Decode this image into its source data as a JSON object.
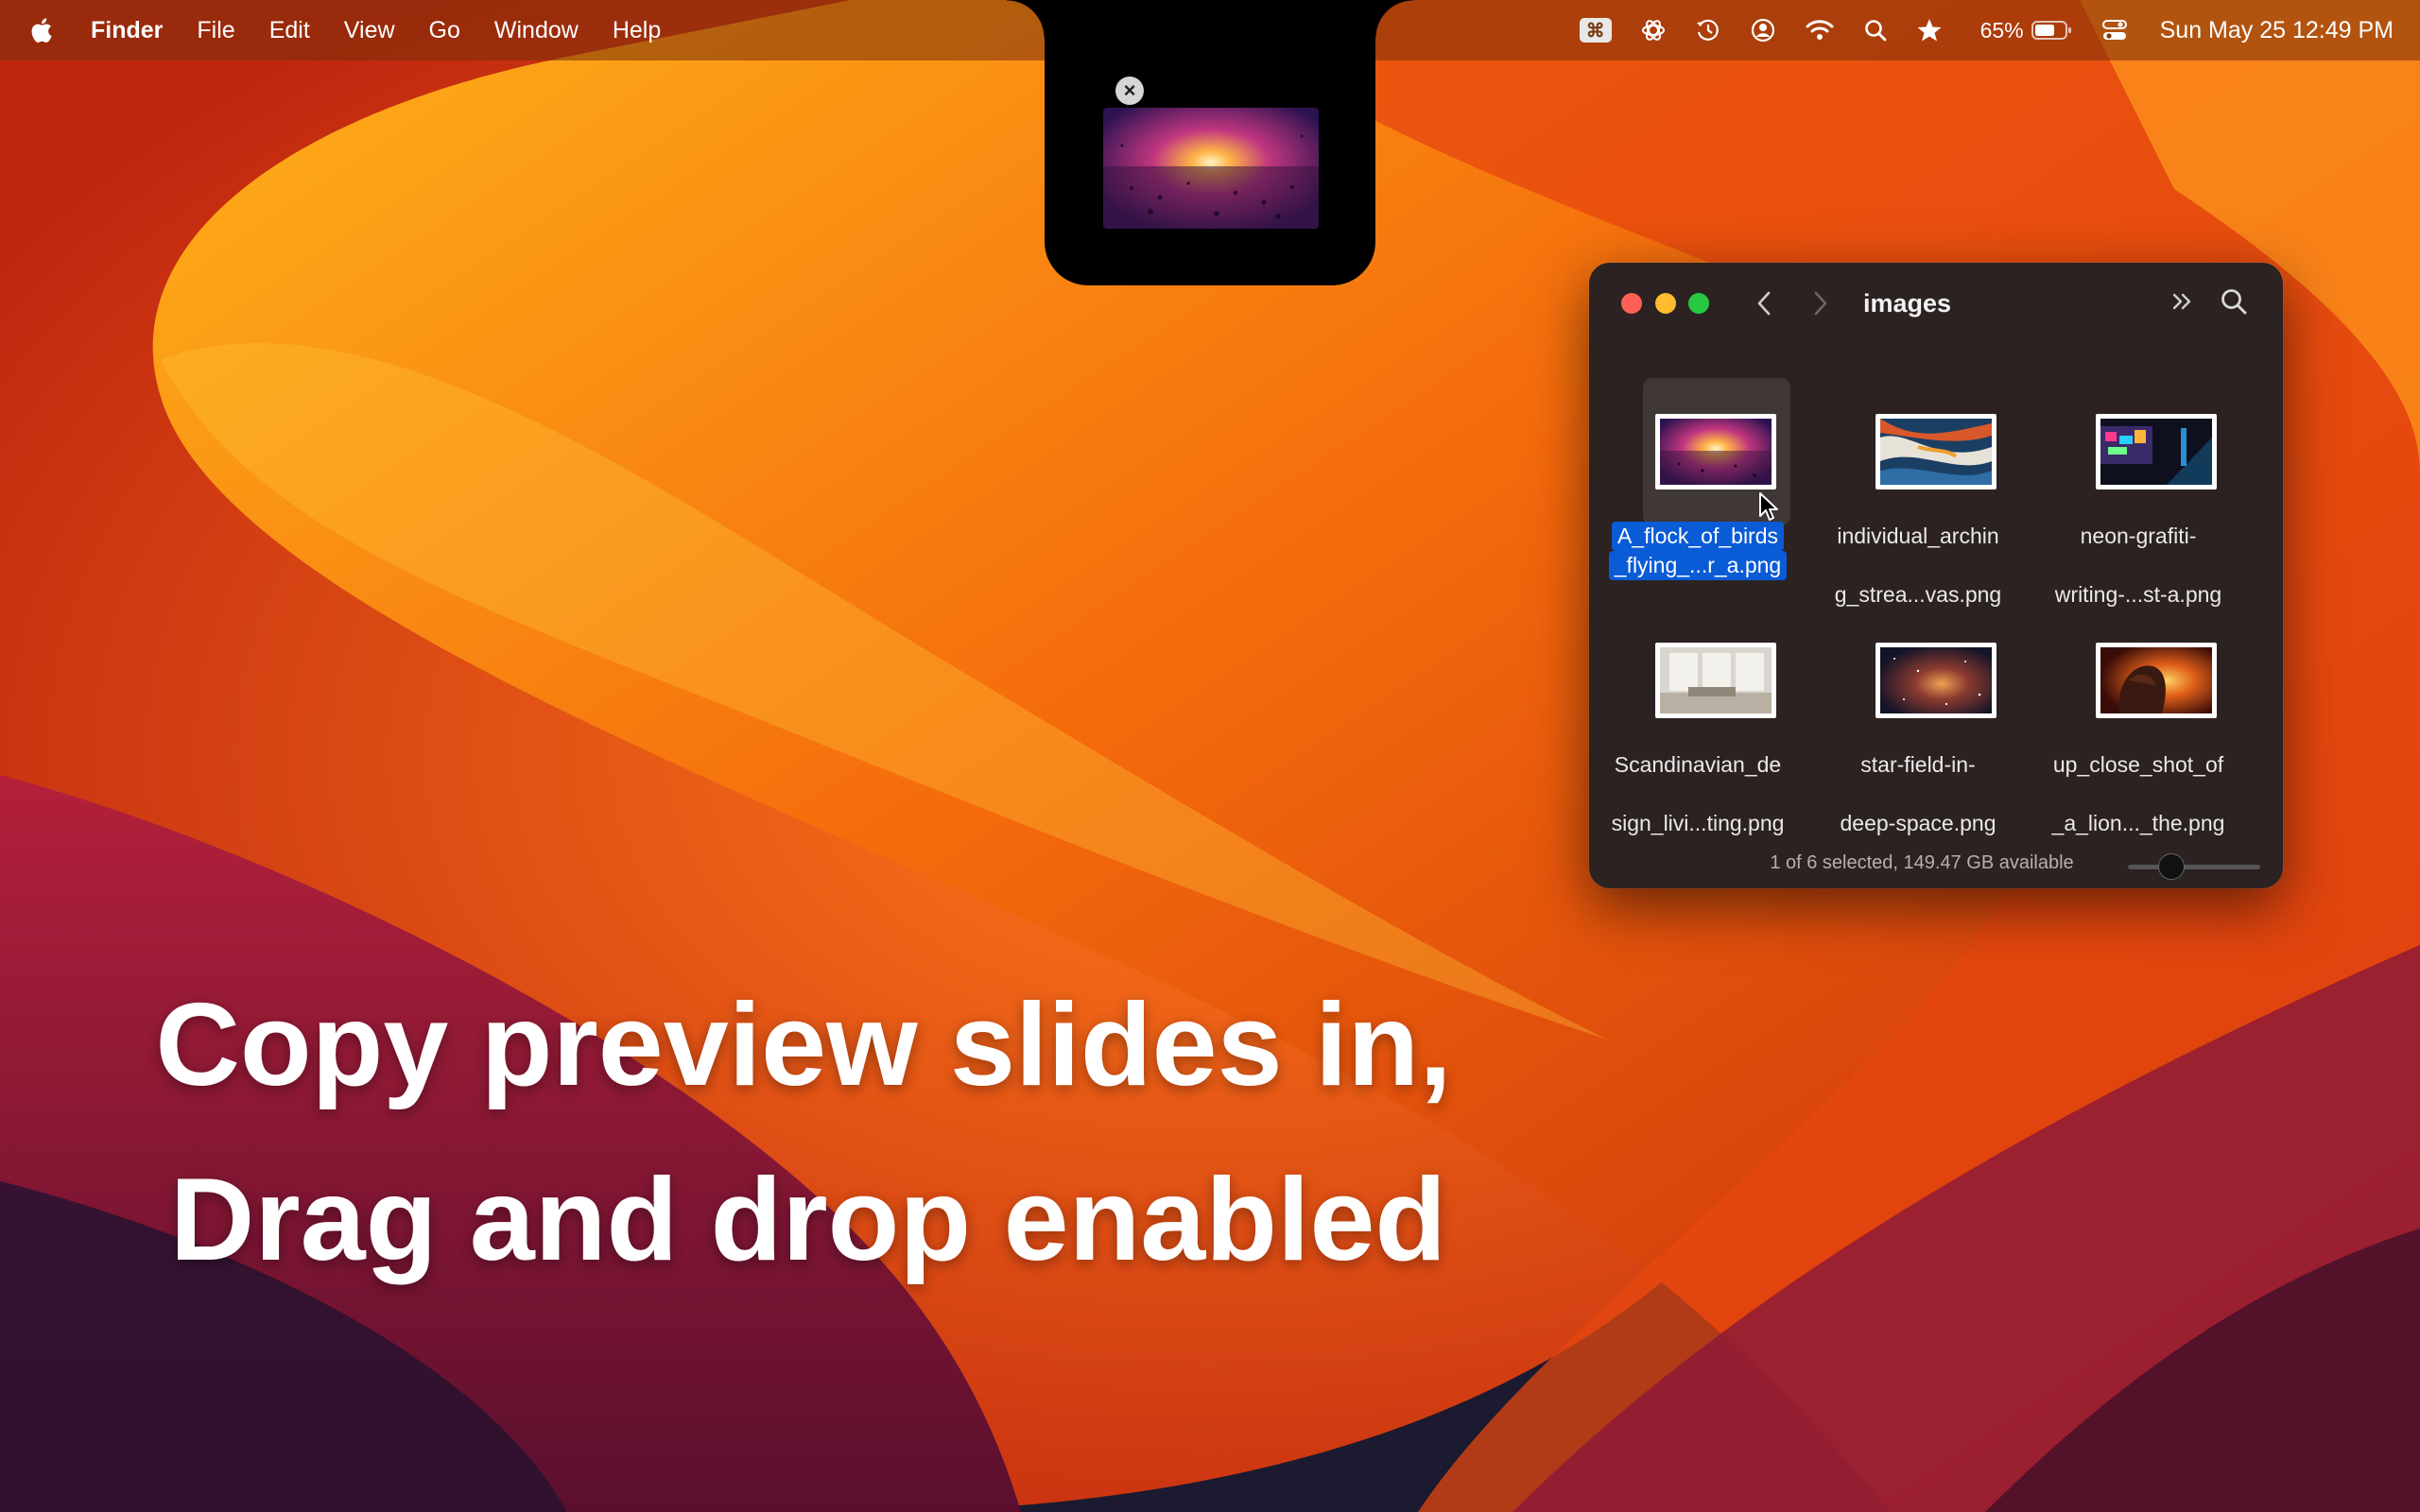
{
  "menubar": {
    "app_name": "Finder",
    "menus": [
      "File",
      "Edit",
      "View",
      "Go",
      "Window",
      "Help"
    ],
    "battery_percent": "65%",
    "datetime": "Sun May 25  12:49 PM",
    "status_icons": [
      "keyboard-shortcut-icon",
      "openai-icon",
      "time-machine-icon",
      "user-account-icon",
      "wifi-icon",
      "spotlight-search-icon",
      "star-icon",
      "battery-icon",
      "control-center-icon"
    ],
    "kbd_glyph": "⌘"
  },
  "notch_shelf": {
    "close_glyph": "×",
    "thumbnail": "A_flock_of_birds_flying_...r_a.png"
  },
  "finder": {
    "title": "images",
    "files": [
      {
        "name_line1": "A_flock_of_birds",
        "name_line2": "_flying_...r_a.png",
        "selected": true
      },
      {
        "name_line1": "individual_archin",
        "name_line2": "g_strea...vas.png",
        "selected": false
      },
      {
        "name_line1": "neon-grafiti-",
        "name_line2": "writing-...st-a.png",
        "selected": false
      },
      {
        "name_line1": "Scandinavian_de",
        "name_line2": "sign_livi...ting.png",
        "selected": false
      },
      {
        "name_line1": "star-field-in-",
        "name_line2": "deep-space.png",
        "selected": false
      },
      {
        "name_line1": "up_close_shot_of",
        "name_line2": "_a_lion..._the.png",
        "selected": false
      }
    ],
    "status": "1 of 6 selected, 149.47 GB available",
    "icon_size_slider": 0.3
  },
  "caption": {
    "line1": "Copy preview slides in,",
    "line2": "Drag and drop enabled"
  },
  "colors": {
    "selection_blue": "#0a5bd6",
    "window_bg": "#2b2221",
    "close": "#fe5f57",
    "minimize": "#febc2e",
    "maximize": "#28c840"
  }
}
